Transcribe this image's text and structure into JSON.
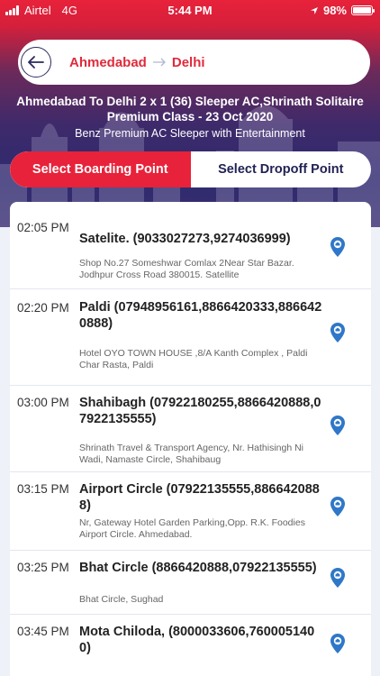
{
  "status": {
    "carrier": "Airtel",
    "network": "4G",
    "time": "5:44 PM",
    "battery": "98%",
    "battery_level": 0.98
  },
  "route": {
    "from": "Ahmedabad",
    "to": "Delhi"
  },
  "trip": {
    "title_line1": "Ahmedabad To Delhi  2 x 1 (36) Sleeper AC,Shrinath Solitaire",
    "title_line2": "Premium Class - 23 Oct 2020",
    "subtitle": "Benz Premium AC Sleeper with Entertainment"
  },
  "tabs": {
    "boarding": "Select Boarding Point",
    "dropoff": "Select Dropoff Point"
  },
  "points": [
    {
      "time": "02:05 PM",
      "name": "Satelite. (9033027273,9274036999)",
      "address": "Shop No.27 Someshwar Comlax 2Near Star Bazar. Jodhpur Cross Road 380015. Satellite"
    },
    {
      "time": "02:20 PM",
      "name": "Paldi (07948956161,8866420333,8866420888)",
      "address": "Hotel OYO TOWN HOUSE  ,8/A Kanth Complex , Paldi Char Rasta, Paldi"
    },
    {
      "time": "03:00 PM",
      "name": "Shahibagh (07922180255,8866420888,07922135555)",
      "address": "Shrinath Travel & Transport Agency, Nr. Hathisingh Ni Wadi, Namaste Circle, Shahibaug"
    },
    {
      "time": "03:15 PM",
      "name": "Airport Circle (07922135555,8866420888)",
      "address": "Nr, Gateway Hotel Garden Parking,Opp. R.K. Foodies Airport Circle. Ahmedabad."
    },
    {
      "time": "03:25 PM",
      "name": "Bhat Circle (8866420888,07922135555)",
      "address": "Bhat Circle, Sughad"
    },
    {
      "time": "03:45 PM",
      "name": "Mota Chiloda, (8000033606,7600051400)",
      "address": ""
    }
  ],
  "icons": {
    "back": "arrow-left-icon",
    "location": "location-pin-icon"
  },
  "colors": {
    "accent_red": "#e8223a",
    "navy": "#222255",
    "pin_blue": "#2f77c8"
  }
}
